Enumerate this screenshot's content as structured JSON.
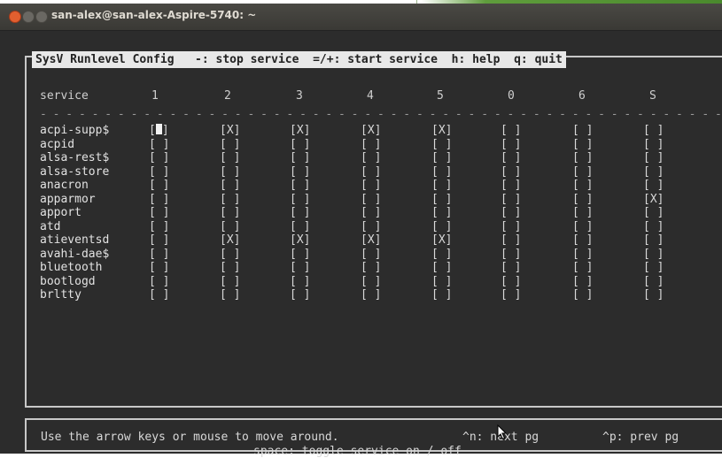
{
  "window": {
    "title": "san-alex@san-alex-Aspire-5740: ~"
  },
  "header": {
    "app_name": "SysV Runlevel Config",
    "stop_hint": "-: stop service",
    "start_hint": "=/+: start service",
    "help_hint": "h: help",
    "quit_hint": "q: quit"
  },
  "columns": {
    "service": "service",
    "runlevels": [
      "1",
      "2",
      "3",
      "4",
      "5",
      "0",
      "6",
      "S"
    ]
  },
  "separator": "- - - - - - - - - - - - - - - - - - - - - - - - - - - - - - - - - - - - - - - - - - - - - - - - - - - - - - - - - - - - - - - - - - - - - - - - - - -",
  "services": [
    {
      "name": "acpi-supp$",
      "states": [
        "[█]",
        "[X]",
        "[X]",
        "[X]",
        "[X]",
        "[ ]",
        "[ ]",
        "[ ]"
      ]
    },
    {
      "name": "acpid",
      "states": [
        "[ ]",
        "[ ]",
        "[ ]",
        "[ ]",
        "[ ]",
        "[ ]",
        "[ ]",
        "[ ]"
      ]
    },
    {
      "name": "alsa-rest$",
      "states": [
        "[ ]",
        "[ ]",
        "[ ]",
        "[ ]",
        "[ ]",
        "[ ]",
        "[ ]",
        "[ ]"
      ]
    },
    {
      "name": "alsa-store",
      "states": [
        "[ ]",
        "[ ]",
        "[ ]",
        "[ ]",
        "[ ]",
        "[ ]",
        "[ ]",
        "[ ]"
      ]
    },
    {
      "name": "anacron",
      "states": [
        "[ ]",
        "[ ]",
        "[ ]",
        "[ ]",
        "[ ]",
        "[ ]",
        "[ ]",
        "[ ]"
      ]
    },
    {
      "name": "apparmor",
      "states": [
        "[ ]",
        "[ ]",
        "[ ]",
        "[ ]",
        "[ ]",
        "[ ]",
        "[ ]",
        "[X]"
      ]
    },
    {
      "name": "apport",
      "states": [
        "[ ]",
        "[ ]",
        "[ ]",
        "[ ]",
        "[ ]",
        "[ ]",
        "[ ]",
        "[ ]"
      ]
    },
    {
      "name": "atd",
      "states": [
        "[ ]",
        "[ ]",
        "[ ]",
        "[ ]",
        "[ ]",
        "[ ]",
        "[ ]",
        "[ ]"
      ]
    },
    {
      "name": "atieventsd",
      "states": [
        "[ ]",
        "[X]",
        "[X]",
        "[X]",
        "[X]",
        "[ ]",
        "[ ]",
        "[ ]"
      ]
    },
    {
      "name": "avahi-dae$",
      "states": [
        "[ ]",
        "[ ]",
        "[ ]",
        "[ ]",
        "[ ]",
        "[ ]",
        "[ ]",
        "[ ]"
      ]
    },
    {
      "name": "bluetooth",
      "states": [
        "[ ]",
        "[ ]",
        "[ ]",
        "[ ]",
        "[ ]",
        "[ ]",
        "[ ]",
        "[ ]"
      ]
    },
    {
      "name": "bootlogd",
      "states": [
        "[ ]",
        "[ ]",
        "[ ]",
        "[ ]",
        "[ ]",
        "[ ]",
        "[ ]",
        "[ ]"
      ]
    },
    {
      "name": "brltty",
      "states": [
        "[ ]",
        "[ ]",
        "[ ]",
        "[ ]",
        "[ ]",
        "[ ]",
        "[ ]",
        "[ ]"
      ]
    }
  ],
  "footer": {
    "nav_hint": "Use the arrow keys or mouse to move around.",
    "next_hint": "^n: next pg",
    "prev_hint": "^p: prev pg",
    "toggle_hint": "space: toggle service on / off"
  }
}
